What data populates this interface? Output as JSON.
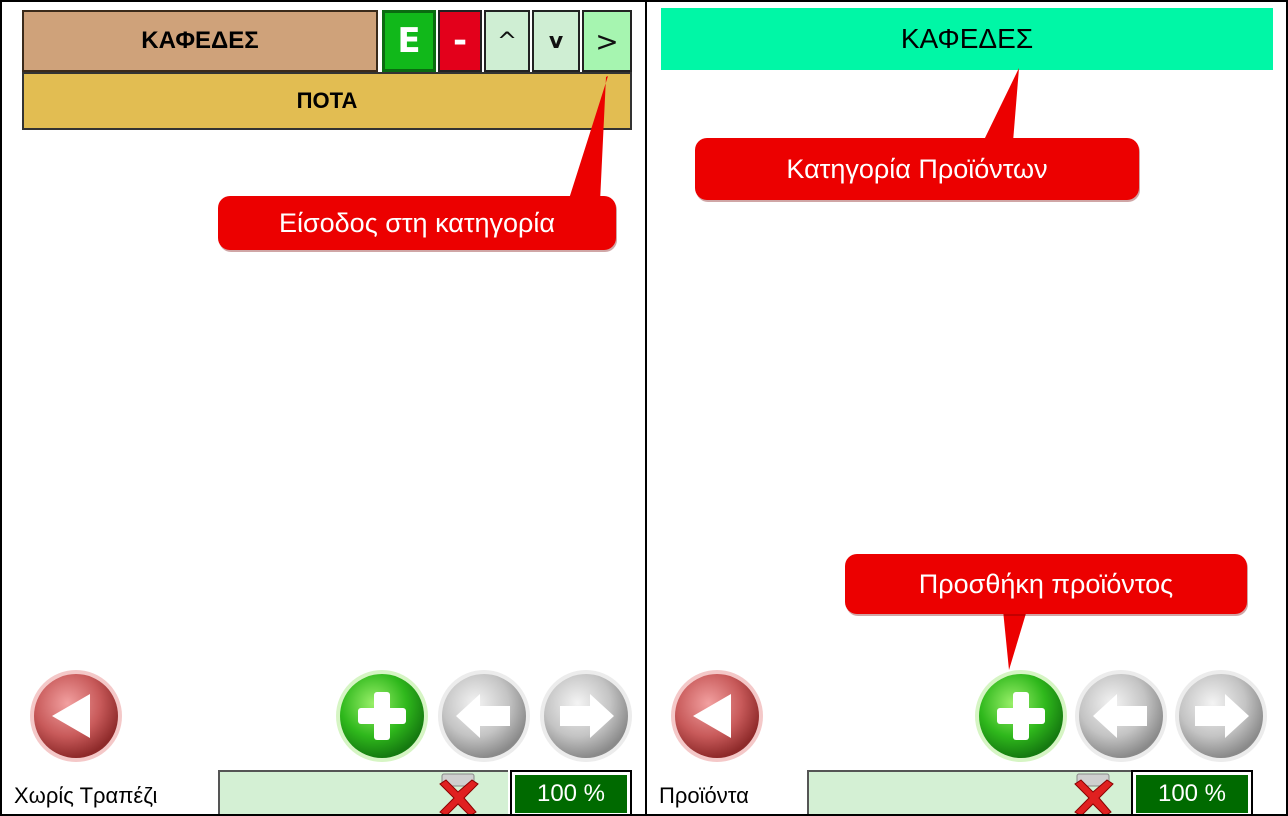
{
  "left": {
    "category_tab": "ΚΑΦΕΔΕΣ",
    "toolbar": {
      "edit_label": "E",
      "delete_label": "-",
      "up_label": "^",
      "down_label": "v",
      "enter_label": ">"
    },
    "subcategory": "ΠΟΤΑ",
    "callout_enter": "Είσοδος στη κατηγορία",
    "status_label": "Χωρίς Τραπέζι",
    "zoom": "100 %"
  },
  "right": {
    "header": "ΚΑΦΕΔΕΣ",
    "callout_category": "Κατηγορία Προϊόντων",
    "callout_add": "Προσθήκη προϊόντος",
    "status_label": "Προϊόντα",
    "zoom": "100 %"
  },
  "icons": {
    "back": "back-arrow-icon",
    "add": "plus-icon",
    "prev": "left-arrow-icon",
    "next": "right-arrow-icon",
    "clear": "clear-x-icon"
  },
  "colors": {
    "category_tab": "#cfa27a",
    "subcategory_bar": "#e2bd52",
    "right_header": "#00f7a6",
    "edit_button": "#11b81a",
    "delete_button": "#e3001b",
    "callout": "#ec0000",
    "zoom_box": "#006a00",
    "status_field": "#d4f0d4"
  }
}
